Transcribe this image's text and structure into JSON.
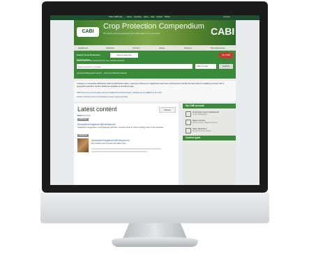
{
  "site": {
    "topbar_links": [
      "Other CABI sites",
      "Home",
      "Overview",
      "About",
      "Help",
      "Contact",
      "Mobile"
    ],
    "account": "Account",
    "logo_text": "CABI",
    "banner_title": "Crop Protection Compendium",
    "banner_subtitle": "The world's most comprehensive site for information on crop protection",
    "banner_brand": "CABI"
  },
  "nav": {
    "items": [
      "Datasheets",
      "Abstracts",
      "Full Text",
      "Library",
      "Glossary",
      "More Resources"
    ]
  },
  "search": {
    "active_tab": "Search Crop Protection Compendium",
    "saved_tab": "Saved searches",
    "my_cabi": "My CABI",
    "hint": "Search over 27,000 datasheets and over 190,000 abstracts",
    "placeholder": "Enter keyword or phrase",
    "filter": "Filter by type",
    "button": "Search",
    "advanced_bib": "Advanced Bibliographic Search",
    "advanced_ds": "Advanced Datasheet Search"
  },
  "notice": {
    "text": "Changes to Compendia distribution data: the distribution tables, maps and references in datasheets have been restructured to handle the data better for updating and align with a geographic standard. Further details are available on the About page.",
    "link1": "PRA Tool for pest commodity and pest Initiated Pest Risk Analysis. Available as an addition to the CPC.",
    "link2": "Horizon Scanning Tool for prioritizing invasive species threats."
  },
  "latest": {
    "title": "Latest content",
    "recent_button": "Recent",
    "section": "Basic",
    "section_link": "All | None",
    "badge1": "Datasheet",
    "item1_title": "Spodoptera frugiperda (fall armyworm)",
    "item1_desc": "Spodoptera frugiperda is a polyphagous pest and, a serious threat to crops including maize in the Americas.",
    "badge2": "Datasheet",
    "item2_title": "Spodoptera frugiperda (fall armyworm)",
    "item2_desc": "Key invasive pest of maize and other crops."
  },
  "sidebar": {
    "account_title": "My CABI Account",
    "rows": [
      {
        "title": "Email and export datasheets",
        "sub": "Create bibliography"
      },
      {
        "title": "Save Content",
        "sub": "Articles, books, images and more"
      },
      {
        "title": "Save Searches",
        "sub": "Access the latest content"
      }
    ],
    "content_types": "Content types"
  }
}
